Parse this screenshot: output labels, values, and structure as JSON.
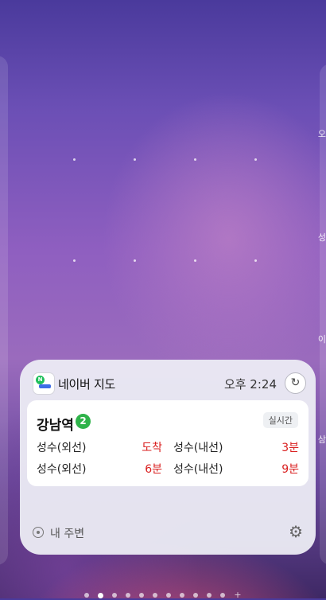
{
  "edge": {
    "right_chars": [
      "오",
      "성",
      "이",
      "삼"
    ]
  },
  "widget": {
    "app_name": "네이버 지도",
    "time": "오후 2:24",
    "refresh_icon": "refresh-icon",
    "station": {
      "name": "강남역",
      "line": "2",
      "line_color": "#2fb34a",
      "realtime_label": "실시간",
      "rows": [
        {
          "left_dir": "성수(외선)",
          "left_eta": "도착",
          "right_dir": "성수(내선)",
          "right_eta": "3분"
        },
        {
          "left_dir": "성수(외선)",
          "left_eta": "6분",
          "right_dir": "성수(내선)",
          "right_eta": "9분"
        }
      ]
    },
    "footer": {
      "nearby_label": "내 주변",
      "nearby_icon": "location-icon",
      "settings_icon": "gear-icon"
    }
  },
  "pager": {
    "total": 11,
    "active_index": 1,
    "plus": "+"
  },
  "colors": {
    "eta_red": "#d91e1e",
    "accent_green": "#1fbf5b"
  }
}
